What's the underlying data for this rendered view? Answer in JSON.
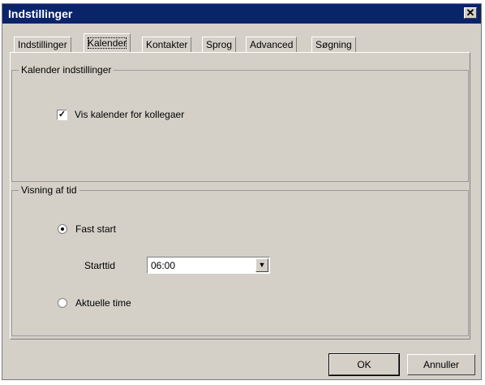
{
  "window": {
    "title": "Indstillinger"
  },
  "icons": {
    "close": "close-icon",
    "dropdown": "chevron-down-icon"
  },
  "tabs": [
    {
      "label": "Indstillinger",
      "active": false
    },
    {
      "label": "Kalender",
      "active": true
    },
    {
      "label": "Kontakter",
      "active": false
    },
    {
      "label": "Sprog",
      "active": false
    },
    {
      "label": "Advanced",
      "active": false
    },
    {
      "label": "Søgning",
      "active": false
    }
  ],
  "calendar_group": {
    "title": "Kalender indstillinger",
    "show_colleagues": {
      "label": "Vis kalender for kollegaer",
      "checked": true
    }
  },
  "time_group": {
    "title": "Visning af tid",
    "fixed_start": {
      "label": "Fast start",
      "selected": true
    },
    "start_time": {
      "label": "Starttid",
      "value": "06:00"
    },
    "current_hour": {
      "label": "Aktuelle time",
      "selected": false
    }
  },
  "buttons": {
    "ok": "OK",
    "cancel": "Annuller"
  }
}
